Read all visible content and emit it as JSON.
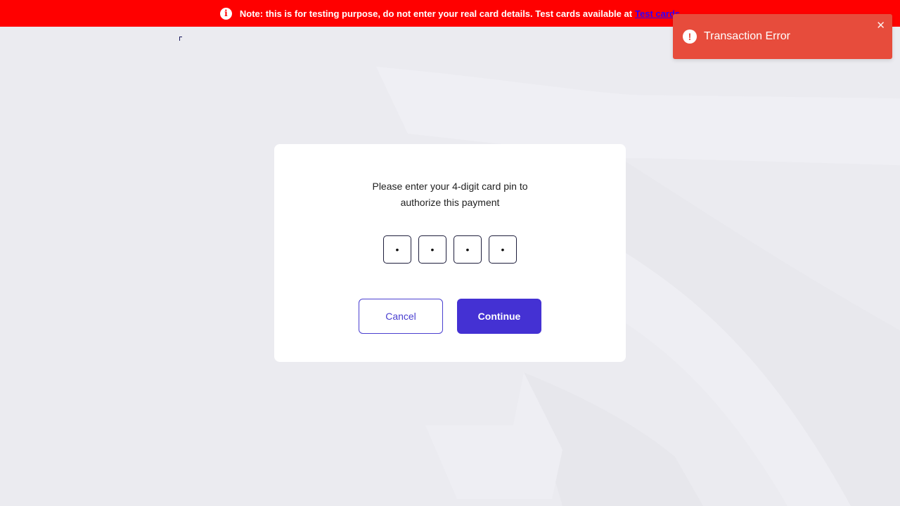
{
  "banner": {
    "icon": "info-icon",
    "icon_glyph": "i",
    "note_text": "Note: this is for testing purpose, do not enter your real card details. Test cards available at",
    "link_text": "Test cards"
  },
  "pin_prompt": {
    "line1": "Please enter your 4-digit card pin to",
    "line2": "authorize this payment"
  },
  "pin_digits": [
    "•",
    "•",
    "•",
    "•"
  ],
  "buttons": {
    "cancel_label": "Cancel",
    "continue_label": "Continue"
  },
  "toast": {
    "icon": "alert-icon",
    "icon_glyph": "!",
    "message": "Transaction Error",
    "close_glyph": "✕"
  },
  "colors": {
    "banner_bg": "#ff0000",
    "link": "#2e00ff",
    "accent": "#4431d3",
    "toast_bg": "#e74c3c",
    "page_bg": "#ebebf0"
  }
}
